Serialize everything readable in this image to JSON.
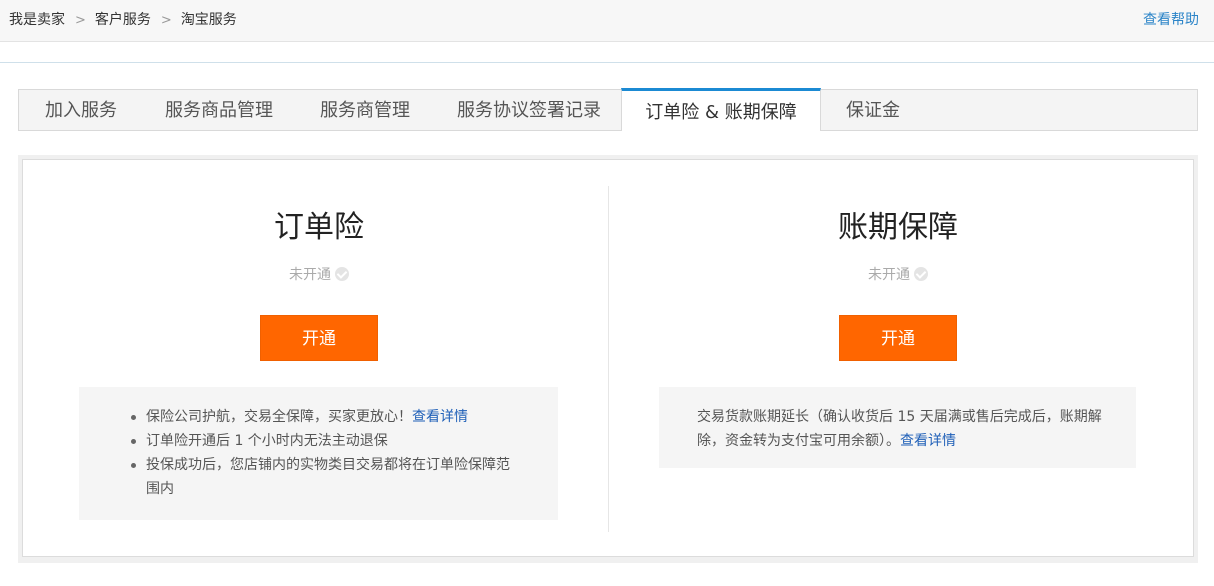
{
  "breadcrumb": [
    "我是卖家",
    "客户服务",
    "淘宝服务"
  ],
  "breadcrumb_separator": ">",
  "help_link": "查看帮助",
  "tabs": [
    {
      "label": "加入服务",
      "active": false
    },
    {
      "label": "服务商品管理",
      "active": false
    },
    {
      "label": "服务商管理",
      "active": false
    },
    {
      "label": "服务协议签署记录",
      "active": false
    },
    {
      "label": "订单险 & 账期保障",
      "active": true
    },
    {
      "label": "保证金",
      "active": false
    }
  ],
  "left": {
    "title": "订单险",
    "status": "未开通",
    "button": "开通",
    "bullets": [
      {
        "text": "保险公司护航，交易全保障，买家更放心！",
        "link": "查看详情"
      },
      {
        "text": "订单险开通后 1 个小时内无法主动退保"
      },
      {
        "text": "投保成功后，您店铺内的实物类目交易都将在订单险保障范围内"
      }
    ]
  },
  "right": {
    "title": "账期保障",
    "status": "未开通",
    "button": "开通",
    "desc": "交易货款账期延长（确认收货后 15 天届满或售后完成后，账期解除，资金转为支付宝可用余额）。",
    "link": "查看详情"
  },
  "colors": {
    "accent": "#ff6600",
    "link": "#2060b8",
    "tab_active_border": "#1b8ad3"
  }
}
